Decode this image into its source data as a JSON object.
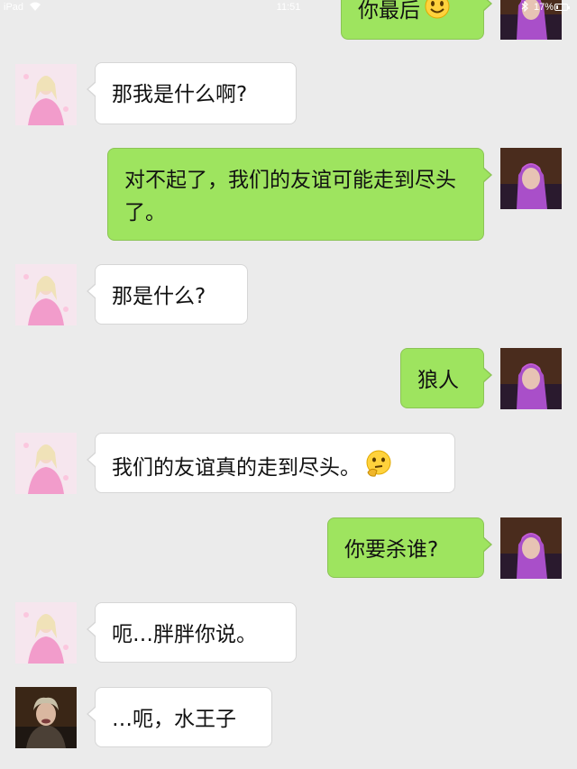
{
  "status_bar": {
    "carrier": "iPad",
    "time": "11:51",
    "battery_percent": "17%",
    "battery_level": 0.17
  },
  "colors": {
    "background": "#ebebeb",
    "outgoing_bubble": "#9ee45f",
    "incoming_bubble": "#ffffff"
  },
  "messages": [
    {
      "side": "right",
      "sender": "me",
      "text": "你最后",
      "emoji": "smiling-face"
    },
    {
      "side": "left",
      "sender": "princess",
      "text": "那我是什么啊?"
    },
    {
      "side": "right",
      "sender": "me",
      "text": "对不起了，我们的友谊可能走到尽头了。"
    },
    {
      "side": "left",
      "sender": "princess",
      "text": "那是什么?"
    },
    {
      "side": "right",
      "sender": "me",
      "text": "狼人"
    },
    {
      "side": "left",
      "sender": "princess",
      "text": "我们的友谊真的走到尽头。",
      "emoji": "thinking-face"
    },
    {
      "side": "right",
      "sender": "me",
      "text": "你要杀谁?"
    },
    {
      "side": "left",
      "sender": "princess",
      "text": "呃…胖胖你说。"
    },
    {
      "side": "left",
      "sender": "water-prince",
      "text": "…呃，水王子"
    }
  ]
}
